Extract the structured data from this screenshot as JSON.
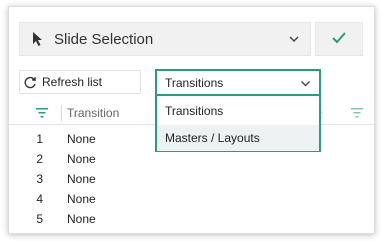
{
  "header": {
    "selector_label": "Slide Selection",
    "cursor_icon": "cursor-arrow-icon",
    "chevron_icon": "chevron-down-icon",
    "confirm_icon": "checkmark-icon",
    "accent_color": "#2b9a7f"
  },
  "toolbar": {
    "refresh_label": "Refresh list",
    "refresh_icon": "refresh-icon",
    "dropdown_value": "Transitions",
    "dropdown_options": [
      "Transitions",
      "Masters / Layouts"
    ]
  },
  "table": {
    "column_header": "Transition",
    "rows": [
      {
        "index": "1",
        "value": "None"
      },
      {
        "index": "2",
        "value": "None"
      },
      {
        "index": "3",
        "value": "None"
      },
      {
        "index": "4",
        "value": "None"
      },
      {
        "index": "5",
        "value": "None"
      }
    ]
  }
}
